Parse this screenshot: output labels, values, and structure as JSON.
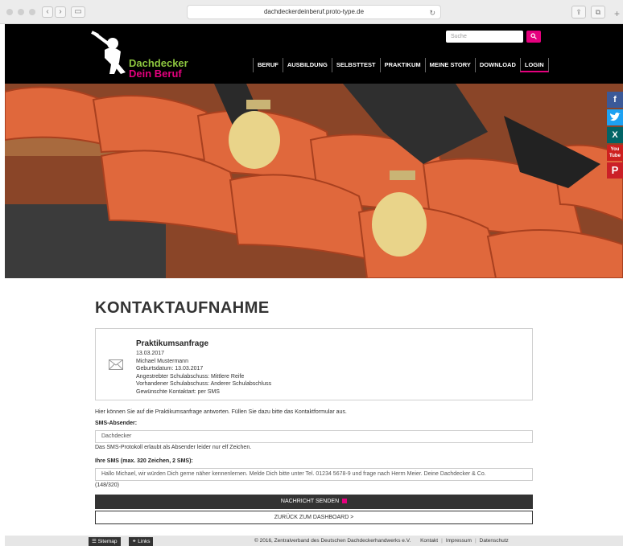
{
  "browser": {
    "url": "dachdeckerdeinberuf.proto-type.de"
  },
  "header": {
    "logo_line1": "Dachdecker",
    "logo_line2": "Dein Beruf",
    "search_placeholder": "Suche",
    "nav": [
      "BERUF",
      "AUSBILDUNG",
      "SELBSTTEST",
      "PRAKTIKUM",
      "MEINE STORY",
      "DOWNLOAD",
      "LOGIN"
    ],
    "active_nav": "LOGIN"
  },
  "social": [
    {
      "name": "facebook-icon",
      "glyph": "f",
      "color": "#3b5998"
    },
    {
      "name": "twitter-icon",
      "glyph": "t",
      "color": "#1da1f2"
    },
    {
      "name": "xing-icon",
      "glyph": "X",
      "color": "#026466"
    },
    {
      "name": "youtube-icon",
      "glyph": "You Tube",
      "color": "#cd201f"
    },
    {
      "name": "pinterest-icon",
      "glyph": "P",
      "color": "#cb2027"
    }
  ],
  "content": {
    "page_title": "KONTAKTAUFNAHME",
    "card": {
      "title": "Praktikumsanfrage",
      "lines": [
        "13.03.2017",
        "Michael Mustermann",
        "Geburtsdatum: 13.03.2017",
        "Angestrebter Schulabschuss: Mittlere Reife",
        "Vorhandener Schulabschuss: Anderer Schulabschluss",
        "Gewünschte Kontaktart: per SMS"
      ]
    },
    "intro": "Hier können Sie auf die Praktikumsanfrage antworten. Füllen Sie dazu bitte das Kontaktformular aus.",
    "sender_label": "SMS-Absender:",
    "sender_value": "Dachdecker",
    "sender_hint": "Das SMS-Protokoll erlaubt als Absender leider nur elf Zeichen.",
    "sms_label": "Ihre SMS (max. 320 Zeichen, 2 SMS):",
    "sms_value": "Hallo Michael, wir würden Dich gerne näher kennenlernen. Melde Dich bitte unter Tel. 01234 5678-9 und frage nach Herrn Meier. Deine Dachdecker & Co.",
    "sms_count": "(148/320)",
    "send_button": "NACHRICHT SENDEN",
    "back_button": "ZURÜCK ZUM DASHBOARD >"
  },
  "footer": {
    "sitemap": "Sitemap",
    "links": "Links",
    "copyright": "© 2016, Zentralverband des Deutschen Dachdeckerhandwerks e.V.",
    "links_right": [
      "Kontakt",
      "Impressum",
      "Datenschutz"
    ]
  },
  "colors": {
    "brand_green": "#8dc63f",
    "brand_pink": "#e5007e",
    "header_bg": "#000000"
  }
}
